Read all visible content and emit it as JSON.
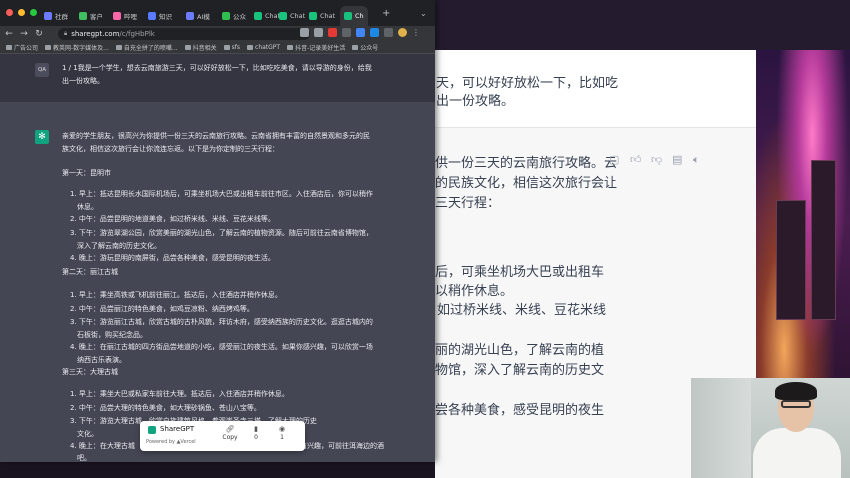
{
  "browser": {
    "tabs": [
      {
        "label": "社群",
        "color": "#6b7cff"
      },
      {
        "label": "客户",
        "color": "#3fbf5f"
      },
      {
        "label": "哔哩",
        "color": "#ff66aa"
      },
      {
        "label": "知识",
        "color": "#5a7bff"
      },
      {
        "label": "AI模",
        "color": "#6b7cff"
      },
      {
        "label": "公众",
        "color": "#2fbf4f"
      },
      {
        "label": "Chat",
        "color": "#19c37d"
      },
      {
        "label": "Chat",
        "color": "#19c37d"
      },
      {
        "label": "Chat",
        "color": "#19c37d"
      },
      {
        "label": "Ch",
        "color": "#19c37d"
      }
    ],
    "url_host": "sharegpt.com",
    "url_path": "/c/fgHbPlk",
    "bookmarks": [
      "广告公司",
      "教英网-数字媒体及...",
      "自充全拼了的喷嘴...",
      "抖音相关",
      "sfs",
      "chatGPT",
      "抖音-记录美好生活",
      "公众号"
    ]
  },
  "chat": {
    "user_avatar": "QA",
    "user_message": "1 / 1我是一个学生，想去云南旅游三天，可以好好放松一下，比如吃吃美食，请以导游的身份，给我出一份攻略。",
    "user_lines": [
      "1 / 1我是一个学生，想去云南旅游三天，可以好好放松一下，比如吃吃美食，请以导游的身份，给我",
      "出一份攻略。"
    ],
    "assistant_lines": [
      "亲爱的学生朋友，很高兴为你提供一份三天的云南旅行攻略。云南省拥有丰富的自然景观和多元的民",
      "族文化，相信这次旅行会让你流连忘返。以下是为你定制的三天行程：",
      "第一天：昆明市",
      "1. 早上：抵达昆明长水国际机场后，可乘坐机场大巴或出租车前往市区。入住酒店后，你可以稍作",
      "休息。",
      "2. 中午：品尝昆明的地道美食，如过桥米线、米线、豆花米线等。",
      "3. 下午：游览翠湖公园，欣赏美丽的湖光山色，了解云南的植物资源。随后可前往云南省博物馆，",
      "深入了解云南的历史文化。",
      "4. 晚上：游玩昆明的南屏街，品尝各种美食，感受昆明的夜生活。",
      "第二天：丽江古城",
      "1. 早上：乘坐高铁或飞机前往丽江。抵达后，入住酒店并稍作休息。",
      "2. 中午：品尝丽江的特色美食，如鸡豆凉粉、纳西烤鸡等。",
      "3. 下午：游览丽江古城，欣赏古城的古朴风貌，拜访木府，感受纳西族的历史文化。逛逛古城内的",
      "石板街，购买纪念品。",
      "4. 晚上：在丽江古城的四方街品尝地道的小吃，感受丽江的夜生活。如果你感兴趣，可以欣赏一场",
      "纳西古乐表演。",
      "第三天：大理古城",
      "1. 早上：乘坐大巴或私家车前往大理。抵达后，入住酒店并稍作休息。",
      "2. 中午：品尝大理的特色美食，如大理砂锅鱼、苍山八宝等。",
      "3. 下午：游览大理古城，欣赏白族建筑风格，参观崇圣寺三塔，了解大理的历史",
      "文化。",
      "4. 晚上：在大理古城",
      "吧。"
    ],
    "bottom_tail": "有兴趣，可前往洱海边的酒"
  },
  "share_popup": {
    "brand": "ShareGPT",
    "powered": "Powered by ▲Vercel",
    "copy_label": "Copy",
    "save_count": "0",
    "view_count": "1"
  },
  "right_window": {
    "lines": [
      "天，可以好好放松一下，比如吃",
      "出一份攻略。",
      "供一份三天的云南旅行攻略。云",
      "的民族文化，相信这次旅行会让",
      "三天行程：",
      "后，可乘坐机场大巴或出租车",
      "以稍作休息。",
      "如过桥米线、米线、豆花米线",
      "丽的湖光山色，了解云南的植",
      "物馆，深入了解云南的历史文",
      "尝各种美食，感受昆明的夜生"
    ]
  }
}
